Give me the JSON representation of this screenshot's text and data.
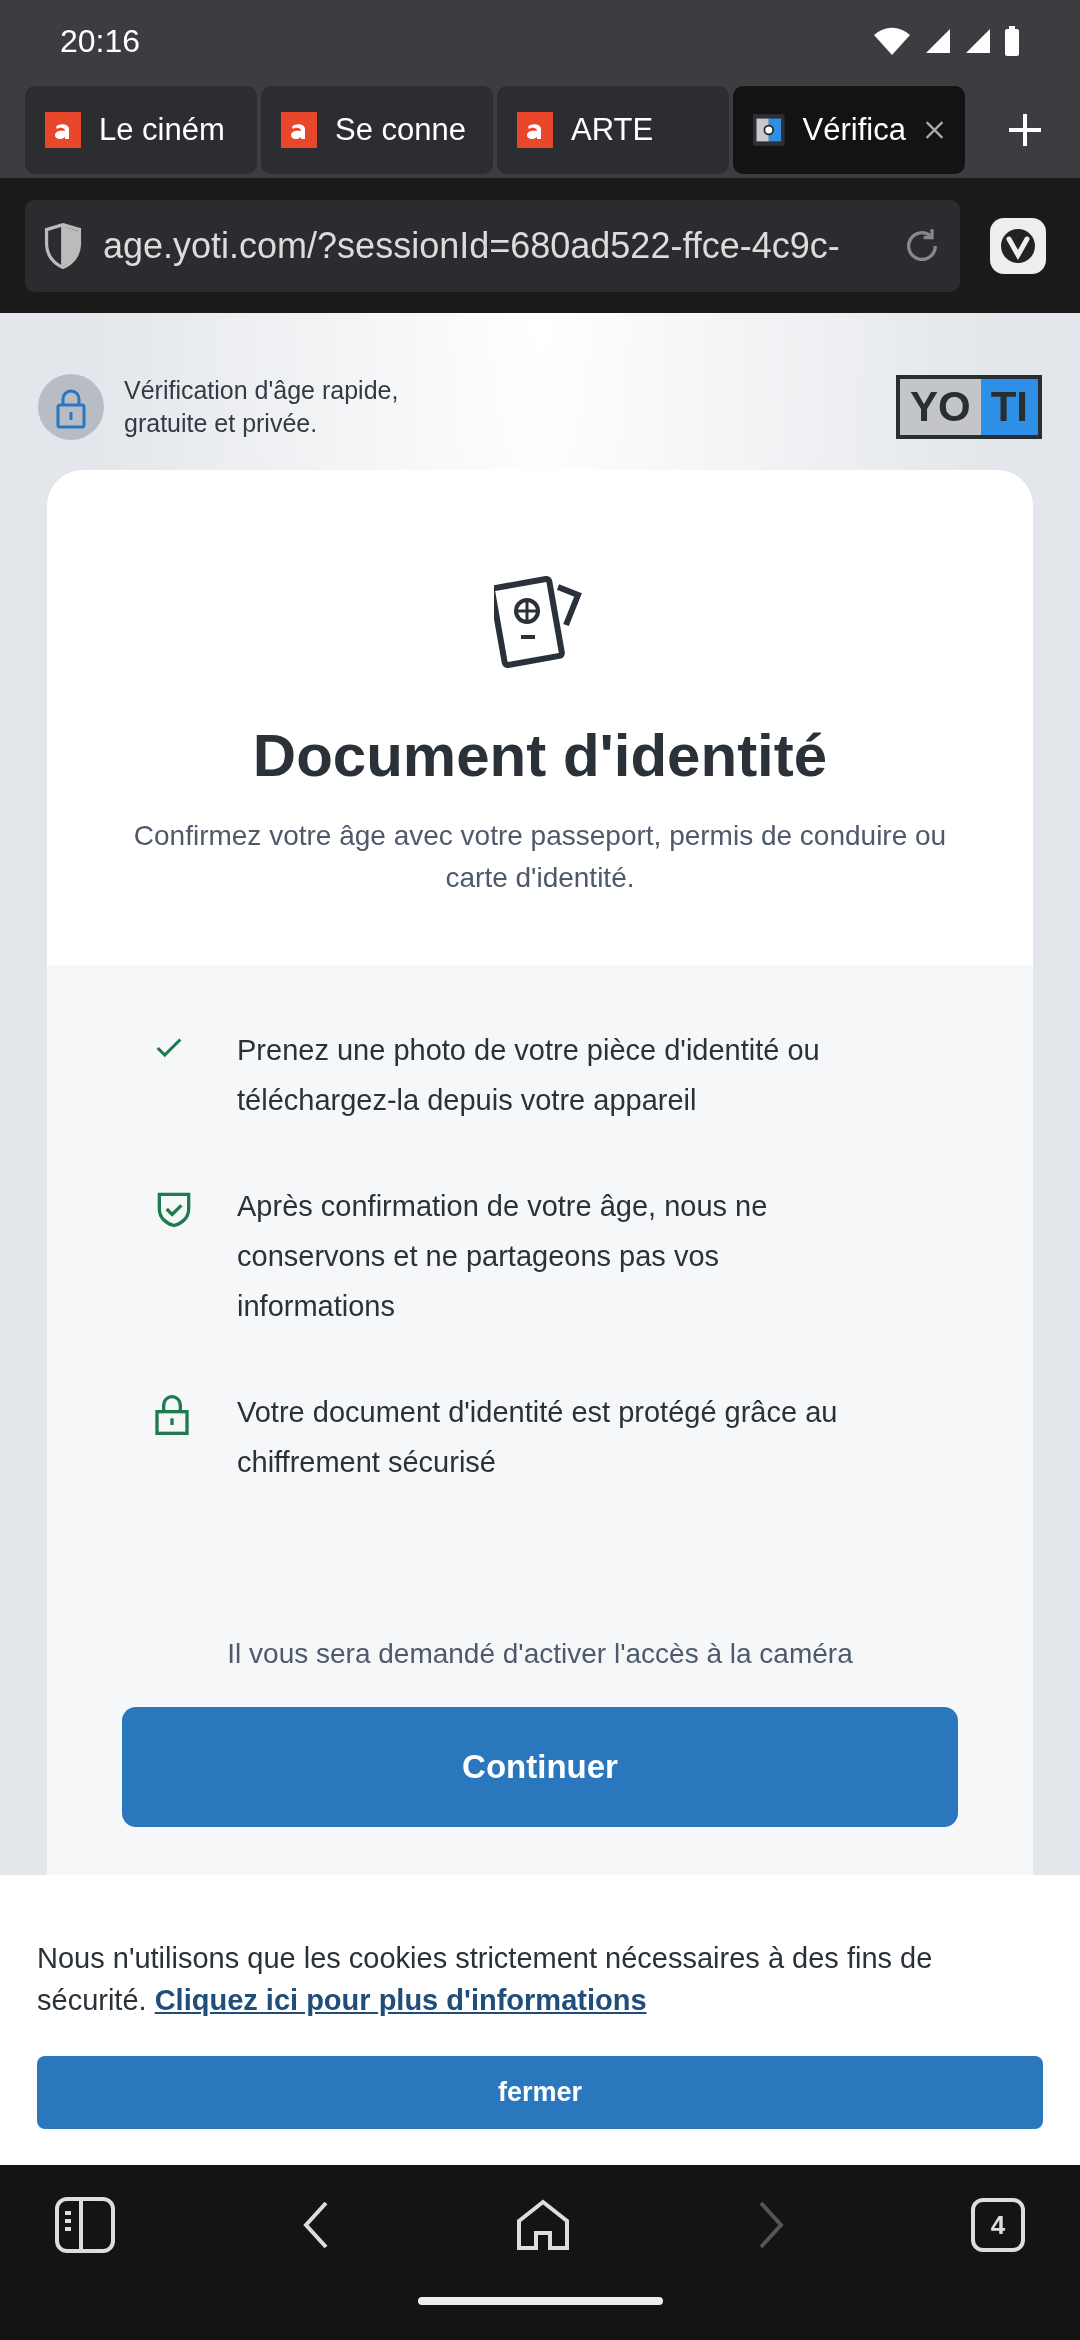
{
  "status_bar": {
    "time": "20:16"
  },
  "tabs": [
    {
      "label": "Le ciném",
      "selected": false
    },
    {
      "label": "Se conne",
      "selected": false
    },
    {
      "label": "ARTE",
      "selected": false
    },
    {
      "label": "Vérifica",
      "selected": true
    }
  ],
  "address_bar": {
    "url": "age.yoti.com/?sessionId=680ad522-ffce-4c9c-"
  },
  "page": {
    "header_note": "Vérification d'âge rapide, gratuite et privée.",
    "logo_left": "YO",
    "logo_right": "TI",
    "card": {
      "title": "Document d'identité",
      "subtitle": "Confirmez votre âge avec votre passeport, permis de conduire ou carte d'identité.",
      "features": [
        {
          "kind": "check",
          "text": "Prenez une photo de votre pièce d'identité ou téléchargez-la depuis votre appareil"
        },
        {
          "kind": "shield",
          "text": "Après confirmation de votre âge, nous ne conservons et ne partageons pas vos informations"
        },
        {
          "kind": "lock",
          "text": "Votre document d'identité est protégé grâce au chiffrement sécurisé"
        }
      ],
      "camera_note": "Il vous sera demandé d'activer l'accès à la caméra",
      "button": "Continuer"
    }
  },
  "cookie_banner": {
    "text": "Nous n'utilisons que les cookies strictement nécessaires à des fins de sécurité.",
    "link": "Cliquez ici pour plus d'informations",
    "button": "fermer"
  },
  "bottom_bar": {
    "tab_count": "4"
  }
}
